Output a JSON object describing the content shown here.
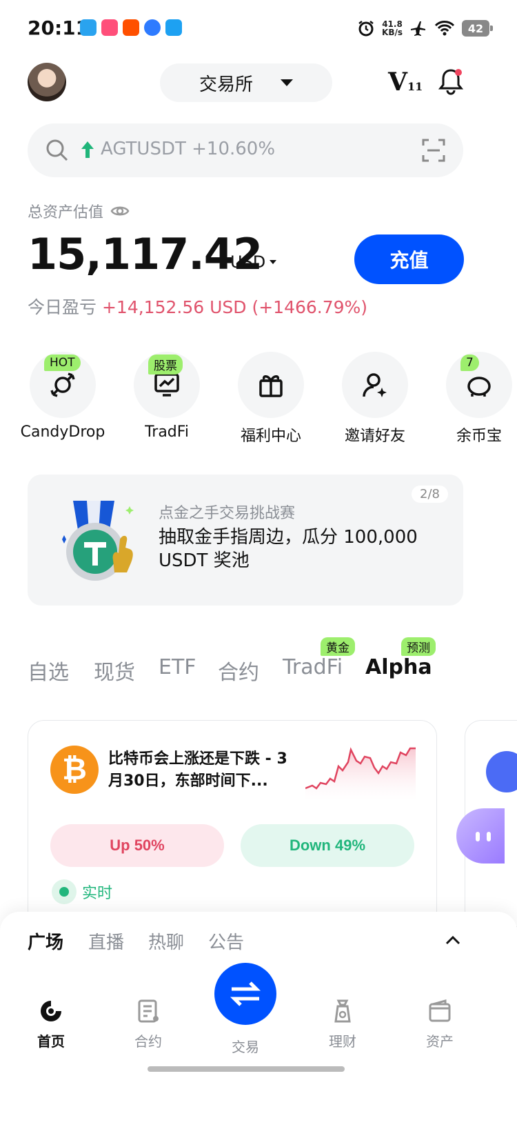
{
  "status_bar": {
    "time": "20:11",
    "net_speed_value": "41.8",
    "net_speed_unit": "KB/s",
    "battery": "42"
  },
  "header": {
    "exchange_label": "交易所",
    "vip_letter": "V",
    "vip_level": "11"
  },
  "search": {
    "trending_text": "AGTUSDT +10.60%"
  },
  "assets": {
    "label": "总资产估值",
    "value": "15,117.42",
    "currency": "USD",
    "deposit_label": "充值",
    "pnl_label": "今日盈亏",
    "pnl_value": "+14,152.56 USD (+1466.79%)"
  },
  "quick_actions": [
    {
      "label": "CandyDrop",
      "badge": "HOT",
      "icon": "candy-icon"
    },
    {
      "label": "TradFi",
      "badge": "股票",
      "icon": "chart-monitor-icon"
    },
    {
      "label": "福利中心",
      "badge": "",
      "icon": "gift-icon"
    },
    {
      "label": "邀请好友",
      "badge": "",
      "icon": "invite-user-icon"
    },
    {
      "label": "余币宝",
      "badge": "7",
      "icon": "piggy-bank-icon"
    }
  ],
  "promo": {
    "counter": "2/8",
    "title": "点金之手交易挑战赛",
    "description": "抽取金手指周边，瓜分 100,000 USDT 奖池"
  },
  "market_tabs": [
    {
      "label": "自选",
      "badge": ""
    },
    {
      "label": "现货",
      "badge": ""
    },
    {
      "label": "ETF",
      "badge": ""
    },
    {
      "label": "合约",
      "badge": ""
    },
    {
      "label": "TradFi",
      "badge": "黄金"
    },
    {
      "label": "Alpha",
      "badge": "预测"
    }
  ],
  "prediction_card": {
    "title": "比特币会上涨还是下跌 - 3月30日，东部时间下...",
    "coin_symbol": "₿",
    "up_label": "Up 50%",
    "down_label": "Down 49%",
    "live_label": "实时"
  },
  "feed_tabs": [
    "广场",
    "直播",
    "热聊",
    "公告"
  ],
  "bottom_nav": [
    {
      "label": "首页",
      "icon": "home-icon"
    },
    {
      "label": "合约",
      "icon": "contract-icon"
    },
    {
      "label": "交易",
      "icon": "trade-swap-icon"
    },
    {
      "label": "理财",
      "icon": "finance-icon"
    },
    {
      "label": "资产",
      "icon": "wallet-icon"
    }
  ],
  "colors": {
    "brand_blue": "#0052ff",
    "up_red": "#e0445f",
    "down_green": "#21b67c",
    "badge_green": "#9dee6d"
  }
}
